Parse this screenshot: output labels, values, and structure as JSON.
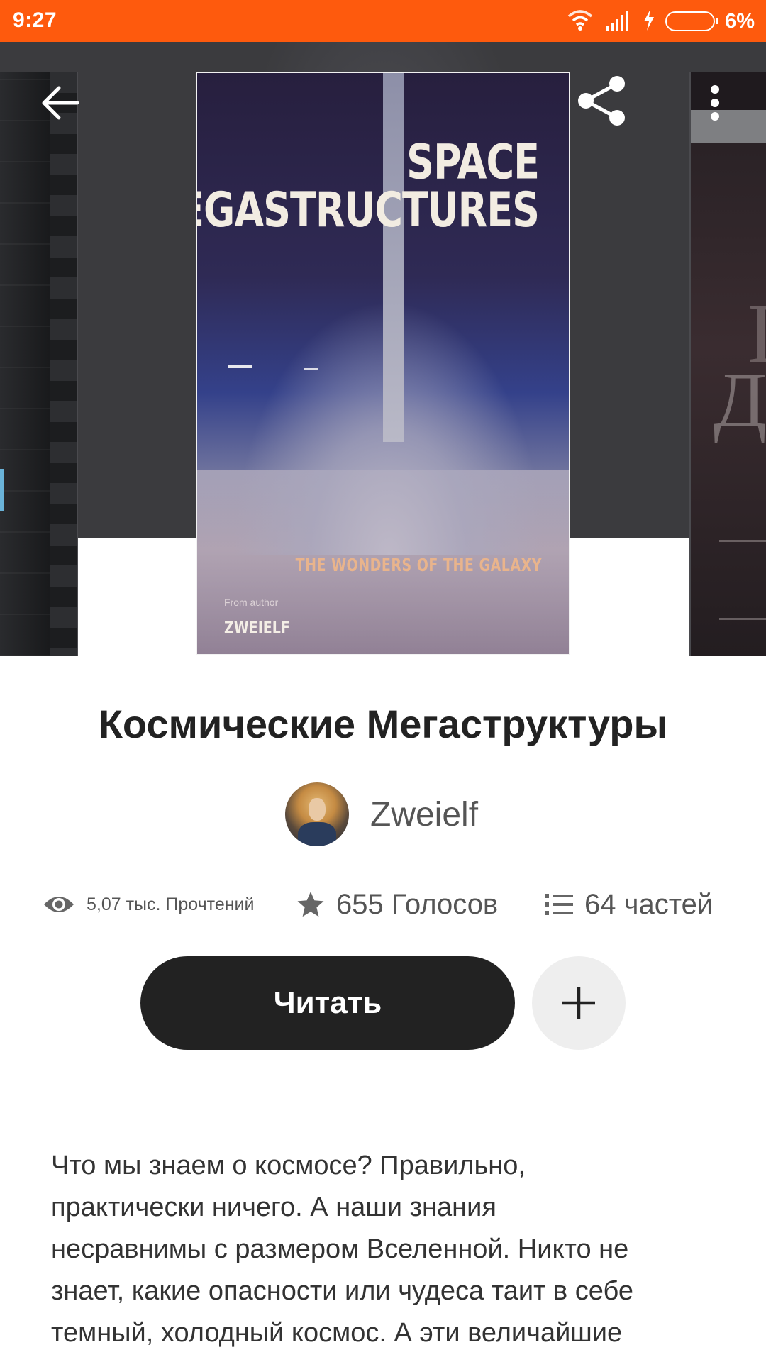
{
  "status_bar": {
    "time": "9:27",
    "battery_percent": "6%",
    "icons": [
      "wifi-icon",
      "signal-icon",
      "charging-icon",
      "battery-icon"
    ]
  },
  "header": {
    "icons": {
      "back": "arrow-left-icon",
      "share": "share-icon",
      "more": "more-vertical-icon"
    }
  },
  "cover": {
    "title_line1": "SPACE",
    "title_line2": "MEGASTRUCTURES",
    "subtitle": "THE WONDERS OF THE GALAXY",
    "from_label": "From author",
    "author": "ZWEIELF"
  },
  "side_cover_right": {
    "glyph_large": "Д",
    "glyph_partial": "Г"
  },
  "book": {
    "title": "Космические Мегаструктуры",
    "author": "Zweielf"
  },
  "stats": {
    "reads": "5,07 тыс. Прочтений",
    "votes": "655 Голосов",
    "parts": "64 частей"
  },
  "actions": {
    "read_label": "Читать",
    "add_icon": "plus-icon"
  },
  "description": {
    "line1": "Что мы знаем о космосе? Правильно,",
    "line2": "практически ничего. А наши знания",
    "line3": "несравнимы с размером Вселенной. Никто не",
    "line4": "знает, какие опасности или чудеса таит в себе",
    "line5": "темный, холодный космос. А эти величайшие"
  },
  "colors": {
    "status_bar": "#fe5a0d",
    "header_bg": "#3b3b3e",
    "read_button": "#222222",
    "add_button": "#eeeeee"
  }
}
